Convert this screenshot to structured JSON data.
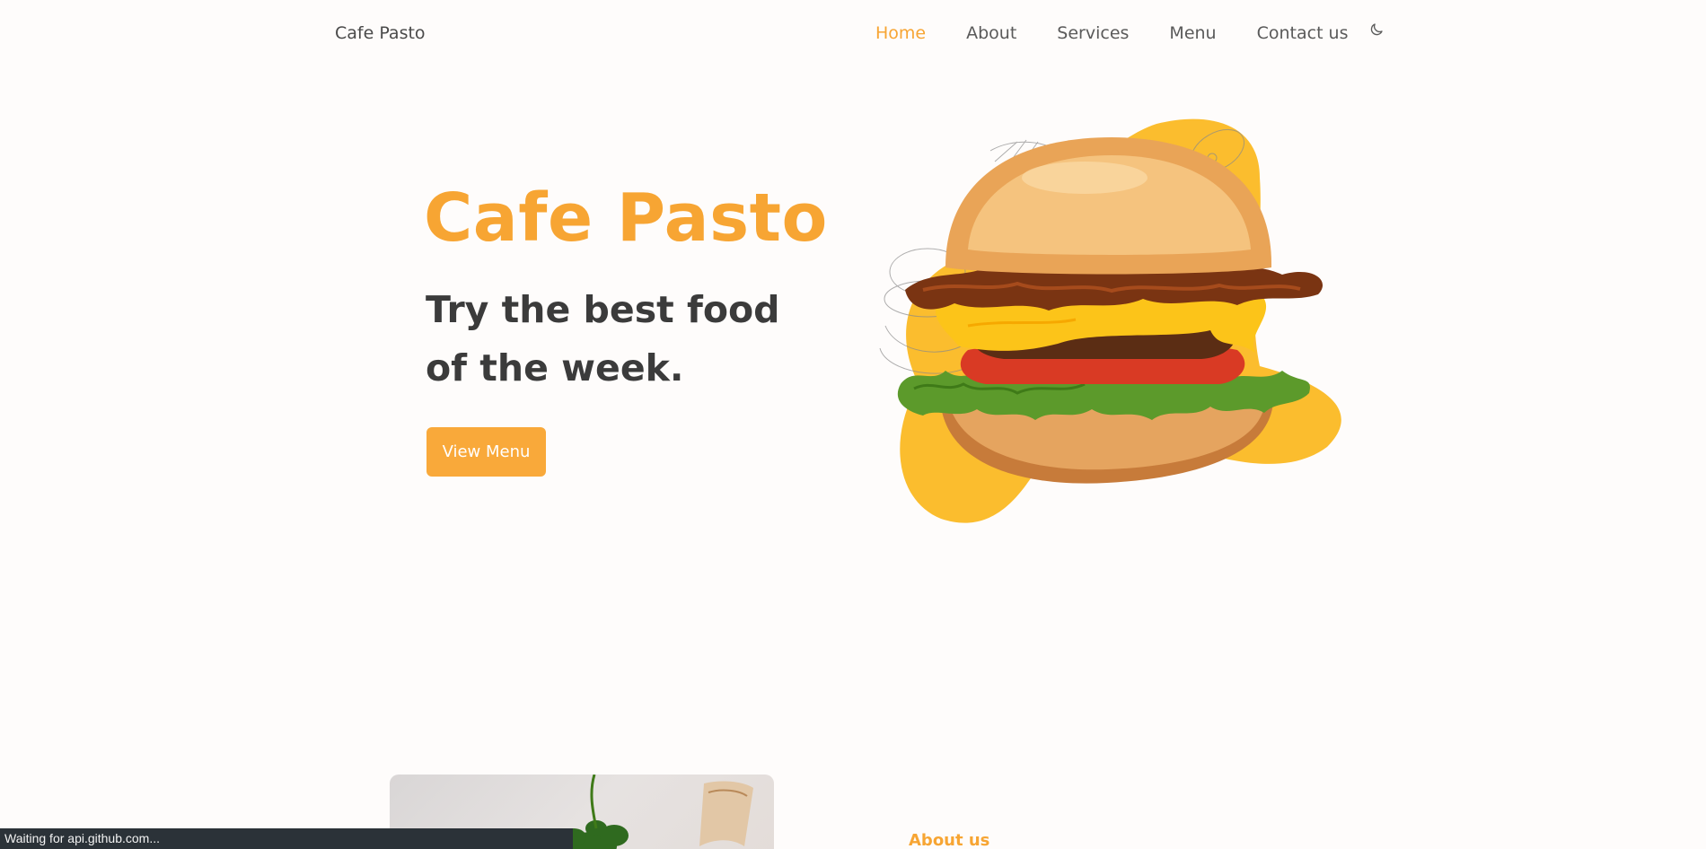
{
  "header": {
    "brand": "Cafe Pasto",
    "nav": [
      {
        "label": "Home",
        "active": true
      },
      {
        "label": "About",
        "active": false
      },
      {
        "label": "Services",
        "active": false
      },
      {
        "label": "Menu",
        "active": false
      },
      {
        "label": "Contact us",
        "active": false
      }
    ],
    "theme_icon": "moon-icon"
  },
  "hero": {
    "title": "Cafe Pasto",
    "subtitle": "Try the best food of the week.",
    "cta_label": "View Menu",
    "image": "burger-image"
  },
  "about": {
    "label": "About us",
    "image": "salad-image"
  },
  "status_bar": {
    "text": "Waiting for api.github.com..."
  },
  "colors": {
    "accent": "#f7a533",
    "button": "#f9a93a",
    "blob": "#fbbd2e",
    "heading": "#3b3b3b",
    "background": "#fefcfb",
    "status_bg": "#2b3238"
  }
}
